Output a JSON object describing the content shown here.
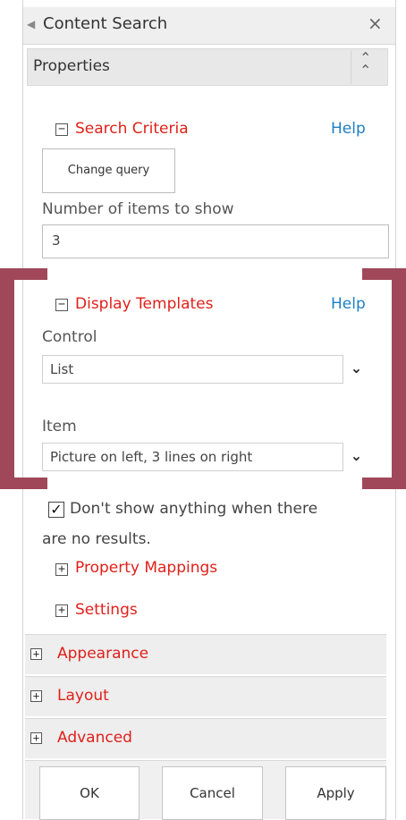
{
  "panel": {
    "title": "Content Search",
    "title_arrow": "◀",
    "close_glyph": "×"
  },
  "properties": {
    "label": "Properties",
    "collapse_glyph": "⌃"
  },
  "search_criteria": {
    "toggle": "−",
    "title": "Search Criteria",
    "help": "Help",
    "change_query": "Change query",
    "num_items_label": "Number of items to show",
    "num_items_value": "3"
  },
  "display_templates": {
    "toggle": "−",
    "title": "Display Templates",
    "help": "Help",
    "control_label": "Control",
    "control_value": "List",
    "item_label": "Item",
    "item_value": "Picture on left, 3 lines on right",
    "dropdown_glyph": "⌄"
  },
  "no_results": {
    "checked": true,
    "check_glyph": "✓",
    "line1": "Don't show anything when there",
    "line2": "are no results."
  },
  "property_mappings": {
    "toggle": "+",
    "title": "Property Mappings"
  },
  "settings": {
    "toggle": "+",
    "title": "Settings"
  },
  "groups": {
    "appearance": {
      "toggle": "+",
      "title": "Appearance"
    },
    "layout": {
      "toggle": "+",
      "title": "Layout"
    },
    "advanced": {
      "toggle": "+",
      "title": "Advanced"
    }
  },
  "footer": {
    "ok": "OK",
    "cancel": "Cancel",
    "apply": "Apply"
  },
  "colors": {
    "section_title": "#e0201a",
    "help_link": "#1d7fc4",
    "bracket": "#a0485a"
  }
}
